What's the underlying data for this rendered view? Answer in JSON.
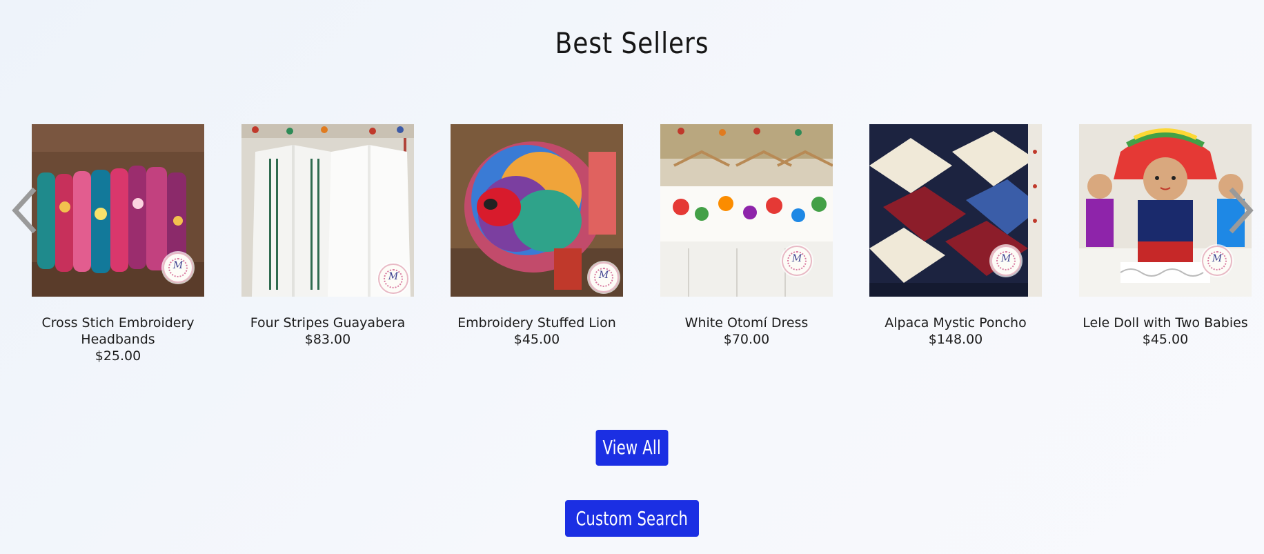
{
  "section": {
    "title": "Best Sellers"
  },
  "products": [
    {
      "name": "Cross Stich Embroidery Headbands",
      "price": "$25.00"
    },
    {
      "name": "Four Stripes Guayabera",
      "price": "$83.00"
    },
    {
      "name": "Embroidery Stuffed Lion",
      "price": "$45.00"
    },
    {
      "name": "White Otomí Dress",
      "price": "$70.00"
    },
    {
      "name": "Alpaca Mystic Poncho",
      "price": "$148.00"
    },
    {
      "name": "Lele Doll with Two Babies",
      "price": "$45.00"
    }
  ],
  "carousel": {
    "prev_icon": "chevron-left-icon",
    "next_icon": "chevron-right-icon"
  },
  "buttons": {
    "view_all": "View All",
    "custom_search": "Custom Search"
  },
  "colors": {
    "button_bg": "#1b2fe3",
    "button_text": "#ffffff",
    "background": "#f3f6fb"
  }
}
